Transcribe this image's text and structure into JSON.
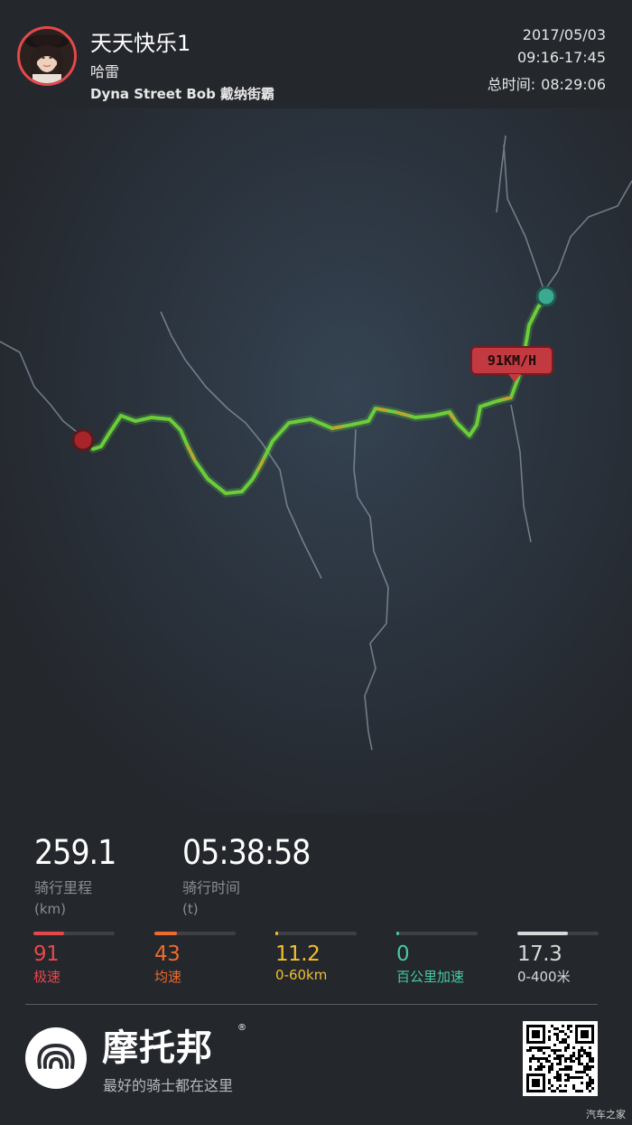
{
  "user": {
    "name": "天天快乐1",
    "nickname": "哈雷",
    "bike": "Dyna Street Bob 戴纳街霸"
  },
  "trip": {
    "date": "2017/05/03",
    "time_range": "09:16-17:45",
    "total_label": "总时间:",
    "total_value": "08:29:06"
  },
  "map": {
    "speed_tag": "91KM/H",
    "route_color": "#6ccd3a",
    "start_color": "#3aa98f",
    "end_color": "#a8242b"
  },
  "stats": {
    "distance": {
      "value": "259.1",
      "label": "骑行里程",
      "unit": "(km)"
    },
    "duration": {
      "value": "05:38:58",
      "label": "骑行时间",
      "unit": "(t)"
    }
  },
  "mini_stats": [
    {
      "value": "91",
      "label": "极速",
      "color": "#e4484c",
      "level": 0.38
    },
    {
      "value": "43",
      "label": "均速",
      "color": "#ee6b2d",
      "level": 0.28
    },
    {
      "value": "11.2",
      "label": "0-60km",
      "color": "#f2c12e",
      "level": 0.03
    },
    {
      "value": "0",
      "label": "百公里加速",
      "color": "#45c9a8",
      "level": 0.03
    },
    {
      "value": "17.3",
      "label": "0-400米",
      "color": "#d8d8d8",
      "level": 0.62
    }
  ],
  "brand": {
    "name": "摩托邦",
    "tm": "®",
    "slogan": "最好的骑士都在这里",
    "logo_icon": "moto-bang-logo-icon",
    "qr_icon": "qr-code-icon"
  },
  "watermark": "汽车之家"
}
